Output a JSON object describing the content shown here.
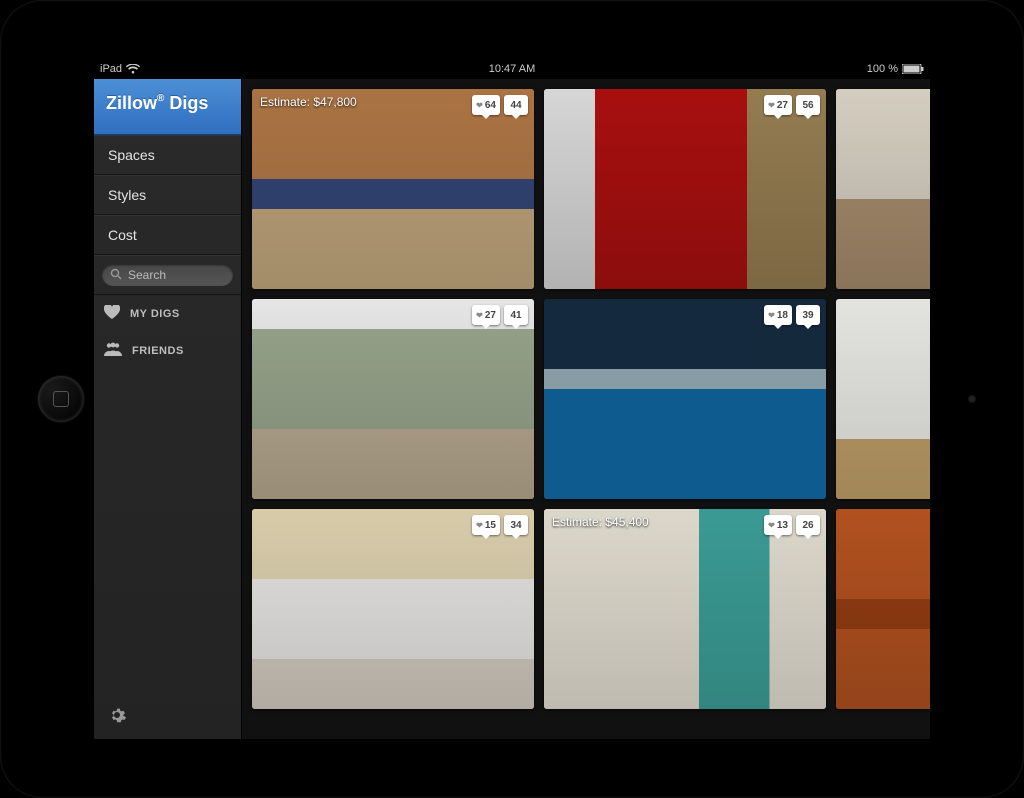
{
  "statusbar": {
    "device": "iPad",
    "time": "10:47 AM",
    "battery": "100 %"
  },
  "brand": {
    "name": "Zillow",
    "suffix": "Digs",
    "reg": "®"
  },
  "sidebar": {
    "items": [
      "Spaces",
      "Styles",
      "Cost"
    ],
    "search_placeholder": "Search",
    "my_digs": "MY DIGS",
    "friends": "FRIENDS"
  },
  "tiles": [
    {
      "estimate": "Estimate: $47,800",
      "likes": "64",
      "comments": "44",
      "room": "kitchen-warm"
    },
    {
      "estimate": "",
      "likes": "27",
      "comments": "56",
      "room": "dining-red"
    },
    {
      "estimate": "",
      "likes": "",
      "comments": "",
      "room": "bedroom",
      "partial": true
    },
    {
      "estimate": "",
      "likes": "27",
      "comments": "41",
      "room": "office-green"
    },
    {
      "estimate": "",
      "likes": "18",
      "comments": "39",
      "room": "pool-modern"
    },
    {
      "estimate": "",
      "likes": "",
      "comments": "",
      "room": "living-bright",
      "partial": true
    },
    {
      "estimate": "",
      "likes": "15",
      "comments": "34",
      "room": "studio"
    },
    {
      "estimate": "Estimate: $45,400",
      "likes": "13",
      "comments": "26",
      "room": "kitchen-teal"
    },
    {
      "estimate": "",
      "likes": "",
      "comments": "",
      "room": "kitchen-orange",
      "partial": true
    }
  ]
}
